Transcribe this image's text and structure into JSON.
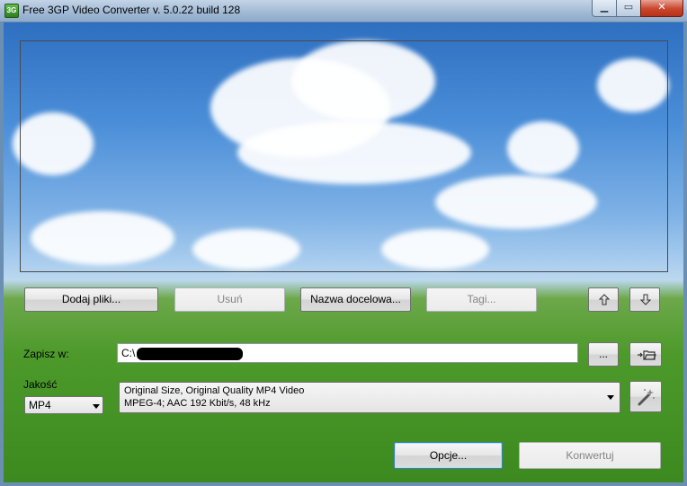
{
  "window": {
    "title": "Free 3GP Video Converter  v. 5.0.22 build 128",
    "app_icon_text": "3G"
  },
  "toolbar": {
    "add_files": "Dodaj pliki...",
    "remove": "Usuń",
    "target_name": "Nazwa docelowa...",
    "tags": "Tagi..."
  },
  "save": {
    "label": "Zapisz w:",
    "path": "C:\\",
    "browse": "..."
  },
  "quality": {
    "label": "Jakość",
    "format": "MP4",
    "preset_line1": "Original Size, Original Quality MP4 Video",
    "preset_line2": "MPEG-4; AAC 192 Kbit/s, 48 kHz"
  },
  "actions": {
    "options": "Opcje...",
    "convert": "Konwertuj"
  },
  "icons": {
    "move_up": "arrow-up-icon",
    "move_down": "arrow-down-icon",
    "open_folder": "folder-open-icon",
    "wand": "magic-wand-icon"
  }
}
